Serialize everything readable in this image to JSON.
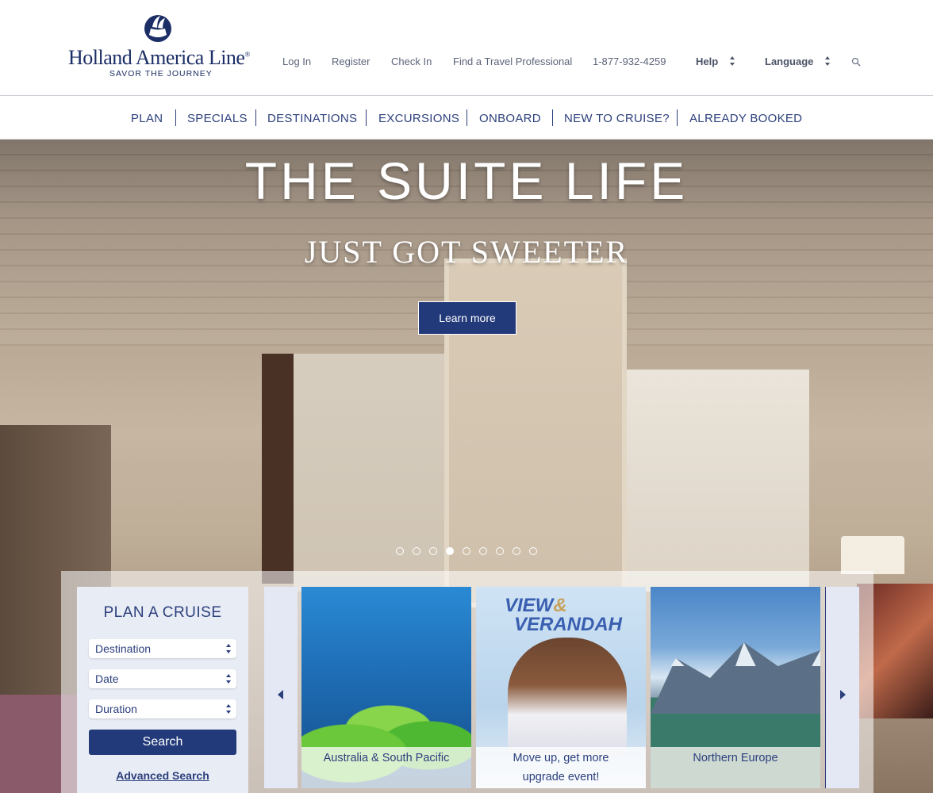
{
  "logo": {
    "name": "Holland America Line",
    "registered": "®",
    "tagline": "SAVOR THE JOURNEY"
  },
  "utility": {
    "login": "Log In",
    "register": "Register",
    "checkin": "Check In",
    "find_agent": "Find a Travel Professional",
    "phone": "1-877-932-4259",
    "help": "Help",
    "language": "Language"
  },
  "nav": [
    "PLAN",
    "SPECIALS",
    "DESTINATIONS",
    "EXCURSIONS",
    "ONBOARD",
    "NEW TO CRUISE?",
    "ALREADY BOOKED"
  ],
  "hero": {
    "title": "THE SUITE LIFE",
    "subtitle": "JUST GOT SWEETER",
    "button": "Learn more",
    "slide_count": 9,
    "active_slide": 4
  },
  "plan": {
    "title": "PLAN A CRUISE",
    "destination": "Destination",
    "date": "Date",
    "duration": "Duration",
    "search": "Search",
    "advanced": "Advanced Search"
  },
  "carousel": {
    "cards": [
      {
        "caption": "Australia & South Pacific"
      },
      {
        "badge_line1": "VIEW",
        "badge_amp": "&",
        "badge_line2": "VERANDAH",
        "caption_line1": "Move up, get more",
        "caption_line2": "upgrade event!"
      },
      {
        "caption": "Northern Europe"
      }
    ]
  },
  "colors": {
    "brand_navy": "#233a7a",
    "nav_text": "#2c3f7c"
  }
}
